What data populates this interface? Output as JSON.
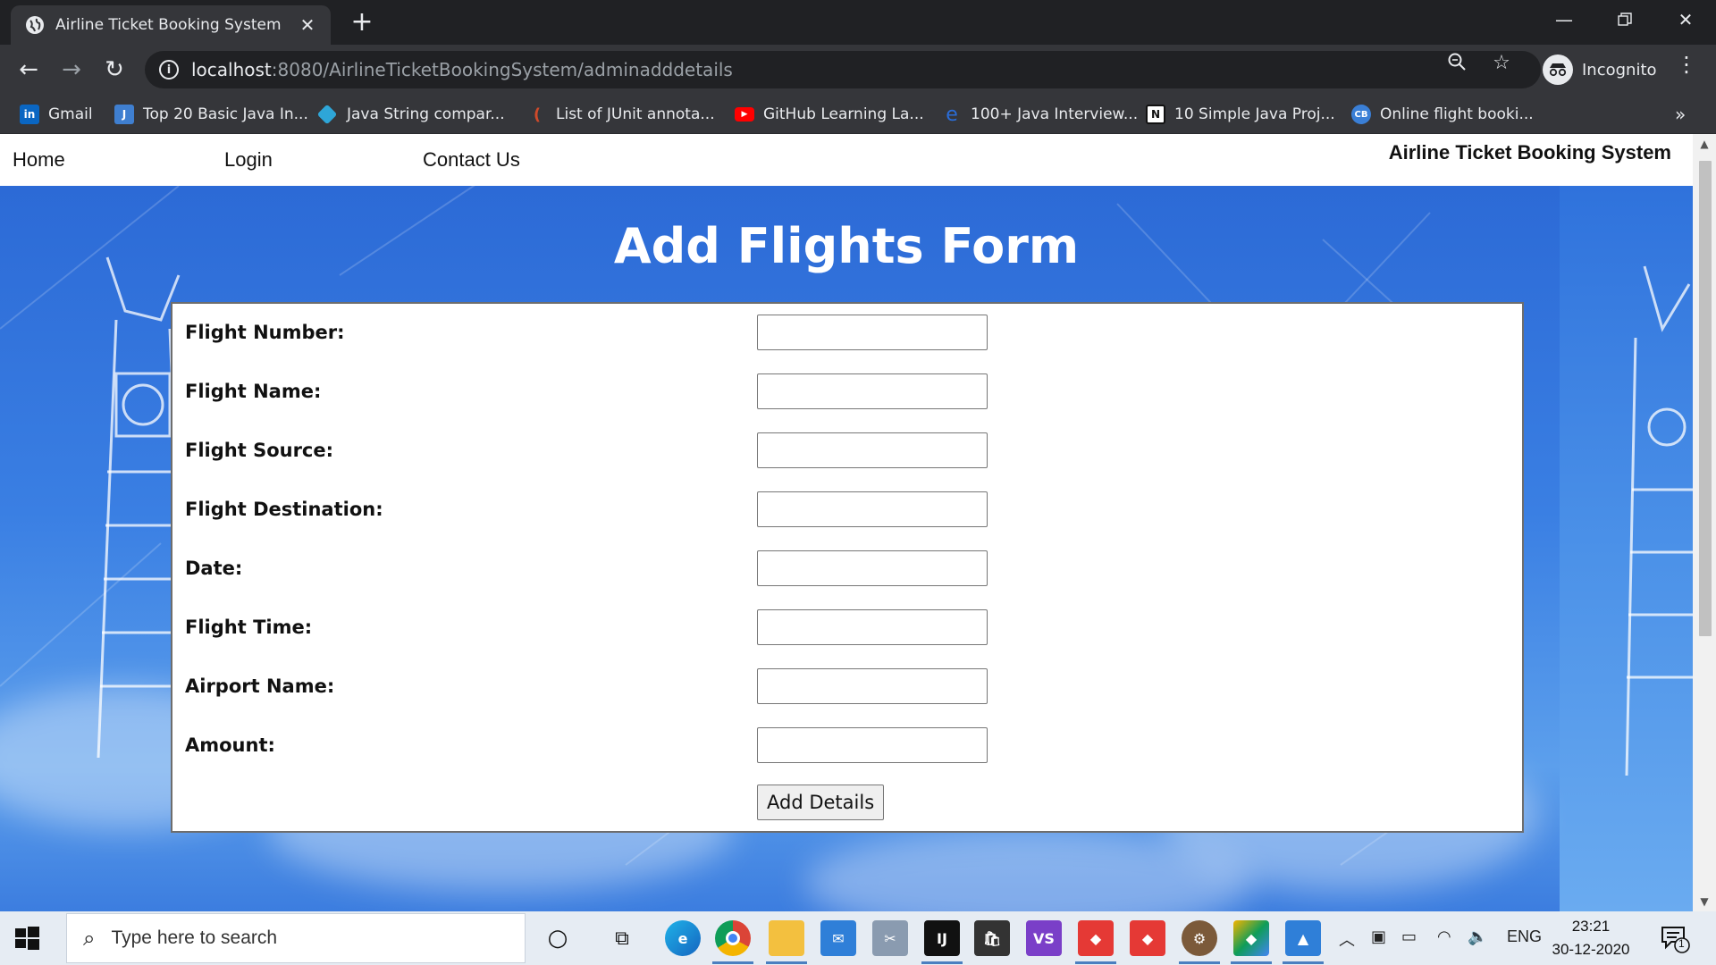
{
  "browser": {
    "tab_title": "Airline Ticket Booking System",
    "url_host": "localhost",
    "url_path": ":8080/AirlineTicketBookingSystem/adminadddetails",
    "profile_label": "Incognito",
    "bookmarks": [
      {
        "label": "Gmail",
        "icon": "linkedin-icon",
        "color": "#0a66c2"
      },
      {
        "label": "Top 20 Basic Java In...",
        "icon": "java-site-icon",
        "color": "#3f7fd0"
      },
      {
        "label": "Java String compar...",
        "icon": "diamond-icon",
        "color": "#2ea6d8"
      },
      {
        "label": "List of JUnit annota...",
        "icon": "feather-icon",
        "color": "#d04a2a"
      },
      {
        "label": "GitHub Learning La...",
        "icon": "youtube-icon",
        "color": "#ff0000"
      },
      {
        "label": "100+ Java Interview...",
        "icon": "e-icon",
        "color": "#2a6dd8"
      },
      {
        "label": "10 Simple Java Proj...",
        "icon": "n-icon",
        "color": "#ffffff"
      },
      {
        "label": "Online flight booki...",
        "icon": "cb-icon",
        "color": "#3a7fd6"
      }
    ]
  },
  "page": {
    "nav": {
      "home": "Home",
      "login": "Login",
      "contact": "Contact Us",
      "brand": "Airline Ticket Booking System"
    },
    "form": {
      "title": "Add Flights Form",
      "fields": [
        {
          "label": "Flight Number:",
          "value": ""
        },
        {
          "label": "Flight Name:",
          "value": ""
        },
        {
          "label": "Flight Source:",
          "value": ""
        },
        {
          "label": "Flight Destination:",
          "value": ""
        },
        {
          "label": "Date:",
          "value": ""
        },
        {
          "label": "Flight Time:",
          "value": ""
        },
        {
          "label": "Airport Name:",
          "value": ""
        },
        {
          "label": "Amount:",
          "value": ""
        }
      ],
      "submit_label": "Add Details"
    }
  },
  "taskbar": {
    "search_placeholder": "Type here to search",
    "language": "ENG",
    "time": "23:21",
    "date": "30-12-2020",
    "notification_count": "1"
  }
}
